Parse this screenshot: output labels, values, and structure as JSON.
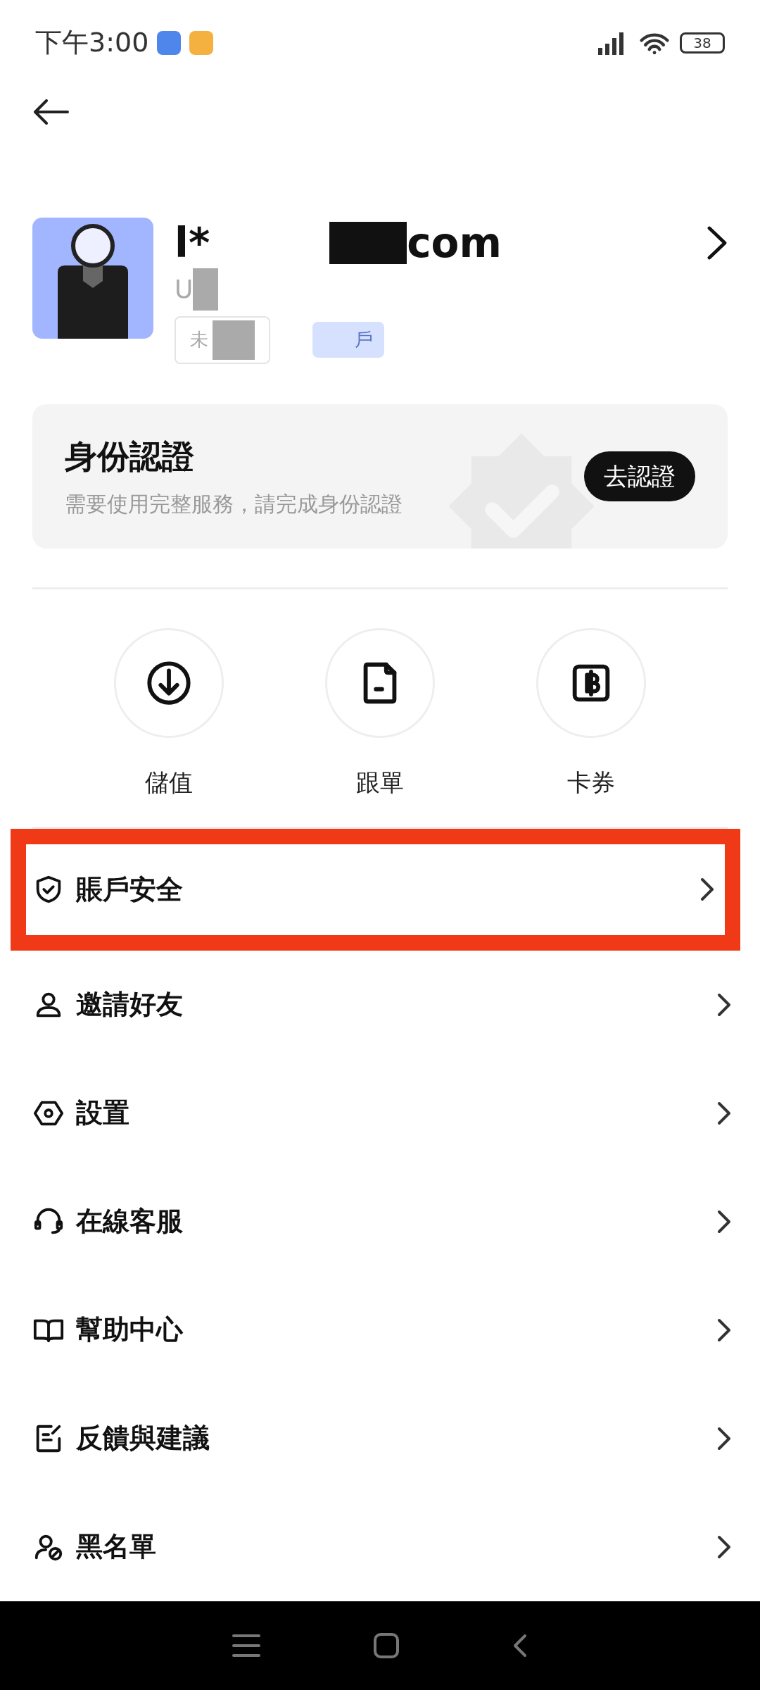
{
  "status_bar": {
    "time": "下午3:00",
    "battery": "38"
  },
  "profile": {
    "email_start": "l*",
    "email_end": "com",
    "user_id": "U",
    "tags": [
      "未",
      "戶"
    ]
  },
  "verification": {
    "title": "身份認證",
    "subtitle": "需要使用完整服務，請完成身份認證",
    "button": "去認證"
  },
  "shortcuts": [
    {
      "kind": "deposit",
      "label": "儲值"
    },
    {
      "kind": "copy",
      "label": "跟單"
    },
    {
      "kind": "coupon",
      "label": "卡券"
    }
  ],
  "menu": [
    {
      "kind": "security",
      "label": "賬戶安全",
      "highlighted": true
    },
    {
      "kind": "invite",
      "label": "邀請好友",
      "highlighted": false
    },
    {
      "kind": "settings",
      "label": "設置",
      "highlighted": false
    },
    {
      "kind": "support",
      "label": "在線客服",
      "highlighted": false
    },
    {
      "kind": "help",
      "label": "幫助中心",
      "highlighted": false
    },
    {
      "kind": "feedback",
      "label": "反饋與建議",
      "highlighted": false
    },
    {
      "kind": "blacklist",
      "label": "黑名單",
      "highlighted": false
    }
  ]
}
